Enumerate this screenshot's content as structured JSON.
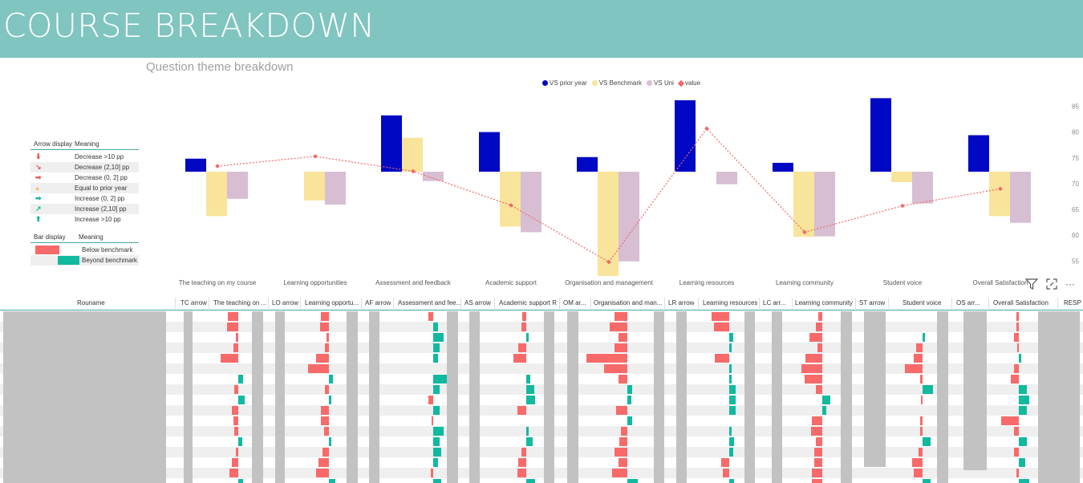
{
  "banner": {
    "title": "COURSE BREAKDOWN"
  },
  "chart_title": "Question theme breakdown",
  "legend": [
    {
      "label": "VS prior year",
      "color": "#0008c4",
      "shape": "dot"
    },
    {
      "label": "VS Benchmark",
      "color": "#f8e49a",
      "shape": "dot"
    },
    {
      "label": "VS Uni",
      "color": "#d7bed3",
      "shape": "dot"
    },
    {
      "label": "value",
      "color": "#f06868",
      "shape": "diamond"
    }
  ],
  "chart_data": {
    "type": "bar",
    "categories": [
      "The teaching on my course",
      "Learning opportunities",
      "Assessment and feedback",
      "Academic support",
      "Organisation and management",
      "Learning resources",
      "Learning community",
      "Student voice",
      "Overall Satisfaction"
    ],
    "series": [
      {
        "name": "VS prior year",
        "values": [
          2.5,
          0,
          10.8,
          7.6,
          2.8,
          13.7,
          1.7,
          14.1,
          7.0
        ]
      },
      {
        "name": "VS Benchmark",
        "values": [
          -8.5,
          -5.5,
          6.5,
          -10.5,
          -20.0,
          0,
          -12.5,
          -2.0,
          -8.5
        ]
      },
      {
        "name": "VS Uni",
        "values": [
          -5.2,
          -6.3,
          -1.8,
          -11.6,
          -17.2,
          -2.4,
          -12.4,
          -6.1,
          -9.8
        ]
      },
      {
        "name": "value",
        "values": [
          73.4,
          75.3,
          72.4,
          65.8,
          54.8,
          80.7,
          60.6,
          65.7,
          69.0
        ]
      }
    ],
    "right_axis": {
      "ticks": [
        85,
        80,
        75,
        70,
        65,
        60,
        55
      ],
      "ylim": [
        52.4,
        86.8
      ]
    },
    "bar_axis_ylim": [
      -20,
      16
    ],
    "colors": [
      "#0008c4",
      "#f8e49a",
      "#d7bed3",
      "#f06868"
    ]
  },
  "key_table": {
    "headers": [
      "Arrow display",
      "Meaning"
    ],
    "rows": [
      {
        "arrow": "⬇",
        "color": "#f05a5a",
        "meaning": "Decrease >10 pp"
      },
      {
        "arrow": "↘",
        "color": "#f05a5a",
        "meaning": "Decrease (2,10] pp"
      },
      {
        "arrow": "➡",
        "color": "#f05a5a",
        "meaning": "Decrease (0, 2] pp"
      },
      {
        "arrow": "●",
        "color": "#f5c070",
        "meaning": "Equal to prior year"
      },
      {
        "arrow": "➡",
        "color": "#11b99f",
        "meaning": "Increase (0, 2] pp"
      },
      {
        "arrow": "↗",
        "color": "#11b99f",
        "meaning": "Increase (2,10] pp"
      },
      {
        "arrow": "⬆",
        "color": "#11b99f",
        "meaning": "Increase >10 pp"
      }
    ]
  },
  "bar_key": {
    "headers": [
      "Bar display",
      "Meaning"
    ],
    "rows": [
      "Below benchmark",
      "Beyond benchmark"
    ]
  },
  "toolbar": {
    "filter_icon": "filter-icon",
    "focus_icon": "focus-mode-icon",
    "more_icon": "more-options-icon",
    "more_label": "···"
  },
  "grid": {
    "headers": [
      "Rouname",
      "TC arrow",
      "The teaching on ...",
      "LO arrow",
      "Learning opportu...",
      "AF arrow",
      "Assessment and fee...",
      "AS arrow",
      "Academic support R",
      "OM ar...",
      "Organisation and man...",
      "LR arrow",
      "Learning resources",
      "LC arr...",
      "Learning community",
      "ST arrow",
      "Student voice",
      "OS arr...",
      "Overall Satisfaction",
      "RESP"
    ]
  }
}
